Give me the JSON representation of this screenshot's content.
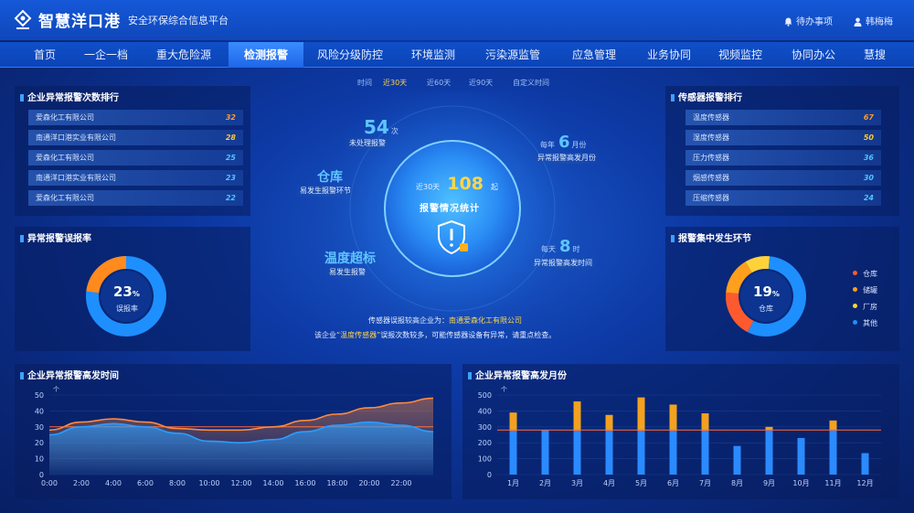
{
  "header": {
    "brand": "智慧洋口港",
    "subtitle": "安全环保综合信息平台",
    "todo_label": "待办事项",
    "user_name": "韩梅梅"
  },
  "nav": [
    "首页",
    "一企一档",
    "重大危险源",
    "检测报警",
    "风险分级防控",
    "环境监测",
    "污染源监管",
    "应急管理",
    "业务协同",
    "视频监控",
    "协同办公",
    "慧搜"
  ],
  "nav_active_index": 3,
  "time_filter": {
    "label": "时间",
    "options": [
      "近30天",
      "近60天",
      "近90天",
      "自定义时间"
    ],
    "active_index": 0
  },
  "enterprise_ranking": {
    "title": "企业异常报警次数排行",
    "rows": [
      {
        "name": "爱森化工有限公司",
        "value": "32"
      },
      {
        "name": "南通洋口港实业有限公司",
        "value": "28"
      },
      {
        "name": "爱森化工有限公司",
        "value": "25"
      },
      {
        "name": "南通洋口港实业有限公司",
        "value": "23"
      },
      {
        "name": "爱森化工有限公司",
        "value": "22"
      }
    ]
  },
  "sensor_ranking": {
    "title": "传感器报警排行",
    "rows": [
      {
        "name": "温度传感器",
        "value": "67"
      },
      {
        "name": "湿度传感器",
        "value": "50"
      },
      {
        "name": "压力传感器",
        "value": "36"
      },
      {
        "name": "烟感传感器",
        "value": "30"
      },
      {
        "name": "压缩传感器",
        "value": "24"
      }
    ]
  },
  "false_alarm": {
    "title": "异常报警误报率",
    "percent": 23,
    "percent_text": "23",
    "unit": "%",
    "label": "误报率",
    "color_main": "#1e8fff",
    "color_accent": "#ff8a1e"
  },
  "alarm_stage": {
    "title": "报警集中发生环节",
    "percent_text": "19",
    "unit": "%",
    "label": "仓库",
    "legend": [
      {
        "name": "仓库",
        "color": "#ff5a2e"
      },
      {
        "name": "储罐",
        "color": "#ff9f1c"
      },
      {
        "name": "厂房",
        "color": "#ffd23a"
      },
      {
        "name": "其他",
        "color": "#1e8fff"
      }
    ],
    "slices": [
      19,
      15,
      10,
      56
    ]
  },
  "center": {
    "total_prefix": "近30天",
    "total_value": "108",
    "total_unit": "起",
    "total_label": "报警情况统计",
    "unhandled_value": "54",
    "unhandled_unit": "次",
    "unhandled_label": "未处理报警",
    "month_prefix": "每年",
    "month_value": "6",
    "month_unit": "月份",
    "month_label": "异常报警高发月份",
    "warehouse_value": "仓库",
    "warehouse_label": "易发生报警环节",
    "temp_value": "温度超标",
    "temp_label": "易发生报警",
    "hour_prefix": "每天",
    "hour_value": "8",
    "hour_unit": "时",
    "hour_label": "异常报警高发时间",
    "info_line1_prefix": "传感器误报较高企业为：",
    "info_line1_company": "南通爱森化工有限公司",
    "info_line2_prefix": "该企业",
    "info_line2_sensor": "“温度传感器”",
    "info_line2_suffix": "误报次数较多，可能传感器设备有异常，请重点检查。"
  },
  "chart_data": [
    {
      "type": "area",
      "title": "企业异常报警高发时间",
      "ylabel": "个",
      "x": [
        "0:00",
        "2:00",
        "4:00",
        "6:00",
        "8:00",
        "10:00",
        "12:00",
        "14:00",
        "16:00",
        "18:00",
        "20:00",
        "22:00",
        "24:00"
      ],
      "xticks": [
        "0:00",
        "2:00",
        "4:00",
        "6:00",
        "8:00",
        "10:00",
        "12:00",
        "14:00",
        "16:00",
        "18:00",
        "20:00",
        "22:00"
      ],
      "ylim": [
        0,
        50
      ],
      "yticks": [
        0,
        10,
        20,
        30,
        40,
        50
      ],
      "reference_line": 30,
      "series": [
        {
          "color": "#ff8a3d",
          "values": [
            28,
            33,
            35,
            33,
            29,
            28,
            28,
            30,
            34,
            38,
            42,
            45,
            48
          ]
        },
        {
          "color": "#2a9dff",
          "values": [
            25,
            30,
            32,
            30,
            26,
            21,
            20,
            22,
            27,
            31,
            33,
            31,
            27
          ]
        }
      ]
    },
    {
      "type": "bar",
      "title": "企业异常报警高发月份",
      "ylabel": "个",
      "categories": [
        "1月",
        "2月",
        "3月",
        "4月",
        "5月",
        "6月",
        "7月",
        "8月",
        "9月",
        "10月",
        "11月",
        "12月"
      ],
      "ylim": [
        0,
        500
      ],
      "yticks": [
        0,
        100,
        200,
        300,
        400,
        500
      ],
      "reference_line": 280,
      "series": [
        {
          "color": "#2a8bff",
          "values": [
            275,
            280,
            275,
            275,
            275,
            275,
            275,
            180,
            280,
            230,
            280,
            135
          ]
        },
        {
          "color": "#f2a21e",
          "values": [
            115,
            0,
            185,
            100,
            210,
            165,
            110,
            0,
            20,
            0,
            60,
            0
          ]
        }
      ]
    }
  ]
}
